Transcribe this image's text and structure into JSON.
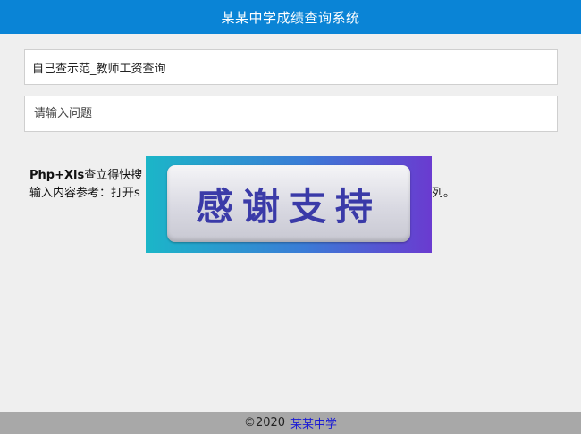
{
  "header": {
    "title": "某某中学成绩查询系统"
  },
  "form": {
    "selected_table": "自己查示范_教师工资查询",
    "query_placeholder": "请输入问题"
  },
  "info": {
    "title_bold": "Php+Xls",
    "title_rest": "查立得快搜",
    "hint": "输入内容参考：打开s",
    "hint_tail": "列。"
  },
  "overlay": {
    "text": "感谢支持"
  },
  "footer": {
    "copyright": "©2020",
    "link_label": "某某中学"
  },
  "colors": {
    "header_bg": "#0a84d6",
    "footer_bg": "#a8a8a8",
    "link": "#1a1ad6"
  }
}
